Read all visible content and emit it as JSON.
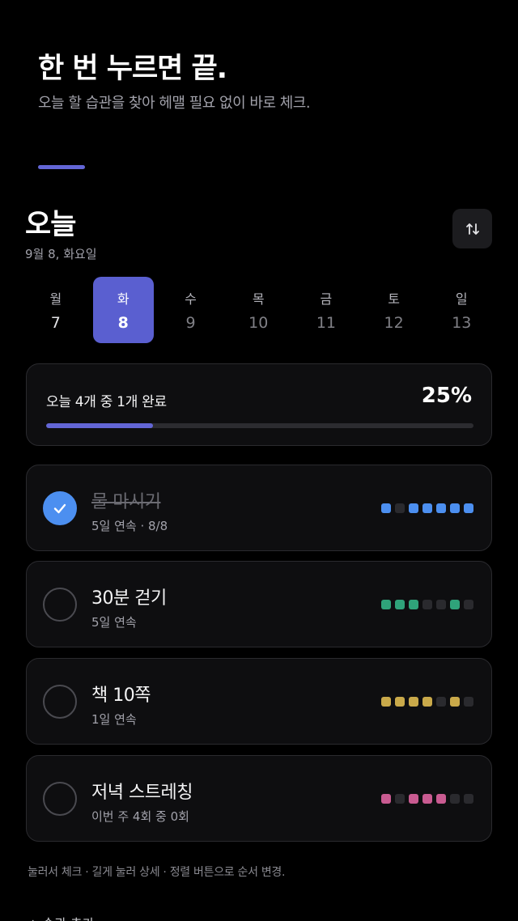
{
  "hero": {
    "title": "한 번 누르면 끝.",
    "subtitle": "오늘 할 습관을 찾아 헤맬 필요 없이 바로 체크."
  },
  "today": {
    "title": "오늘",
    "date": "9월 8, 화요일",
    "sort_icon": "sort-arrows-icon"
  },
  "week": [
    {
      "name": "월",
      "num": "7",
      "state": "past"
    },
    {
      "name": "화",
      "num": "8",
      "state": "selected"
    },
    {
      "name": "수",
      "num": "9",
      "state": "future"
    },
    {
      "name": "목",
      "num": "10",
      "state": "future"
    },
    {
      "name": "금",
      "num": "11",
      "state": "future"
    },
    {
      "name": "토",
      "num": "12",
      "state": "future"
    },
    {
      "name": "일",
      "num": "13",
      "state": "future"
    }
  ],
  "progress": {
    "text": "오늘 4개 중 1개 완료",
    "percent_label": "25%",
    "fraction": 0.25
  },
  "habits": [
    {
      "name": "물 마시기",
      "sub": "5일 연속 · 8/8",
      "done": true,
      "color": "#4c8ff0",
      "history": [
        1,
        0,
        1,
        1,
        1,
        1,
        1
      ]
    },
    {
      "name": "30분 걷기",
      "sub": "5일 연속",
      "done": false,
      "color": "#2fa37a",
      "history": [
        1,
        1,
        1,
        0,
        0,
        1,
        0
      ]
    },
    {
      "name": "책 10쪽",
      "sub": "1일 연속",
      "done": false,
      "color": "#c9a94a",
      "history": [
        1,
        1,
        1,
        1,
        0,
        1,
        0
      ]
    },
    {
      "name": "저녁 스트레칭",
      "sub": "이번 주 4회 중 0회",
      "done": false,
      "color": "#c95b91",
      "history": [
        1,
        0,
        1,
        1,
        1,
        0,
        0
      ]
    }
  ],
  "hint": "눌러서 체크 · 길게 눌러 상세 · 정렬 버튼으로 순서 변경.",
  "add_label": "+ 습관 추가",
  "colors": {
    "accent": "#6366d6",
    "check_done": "#4c8ff0",
    "card_bg": "#0e0e10"
  }
}
